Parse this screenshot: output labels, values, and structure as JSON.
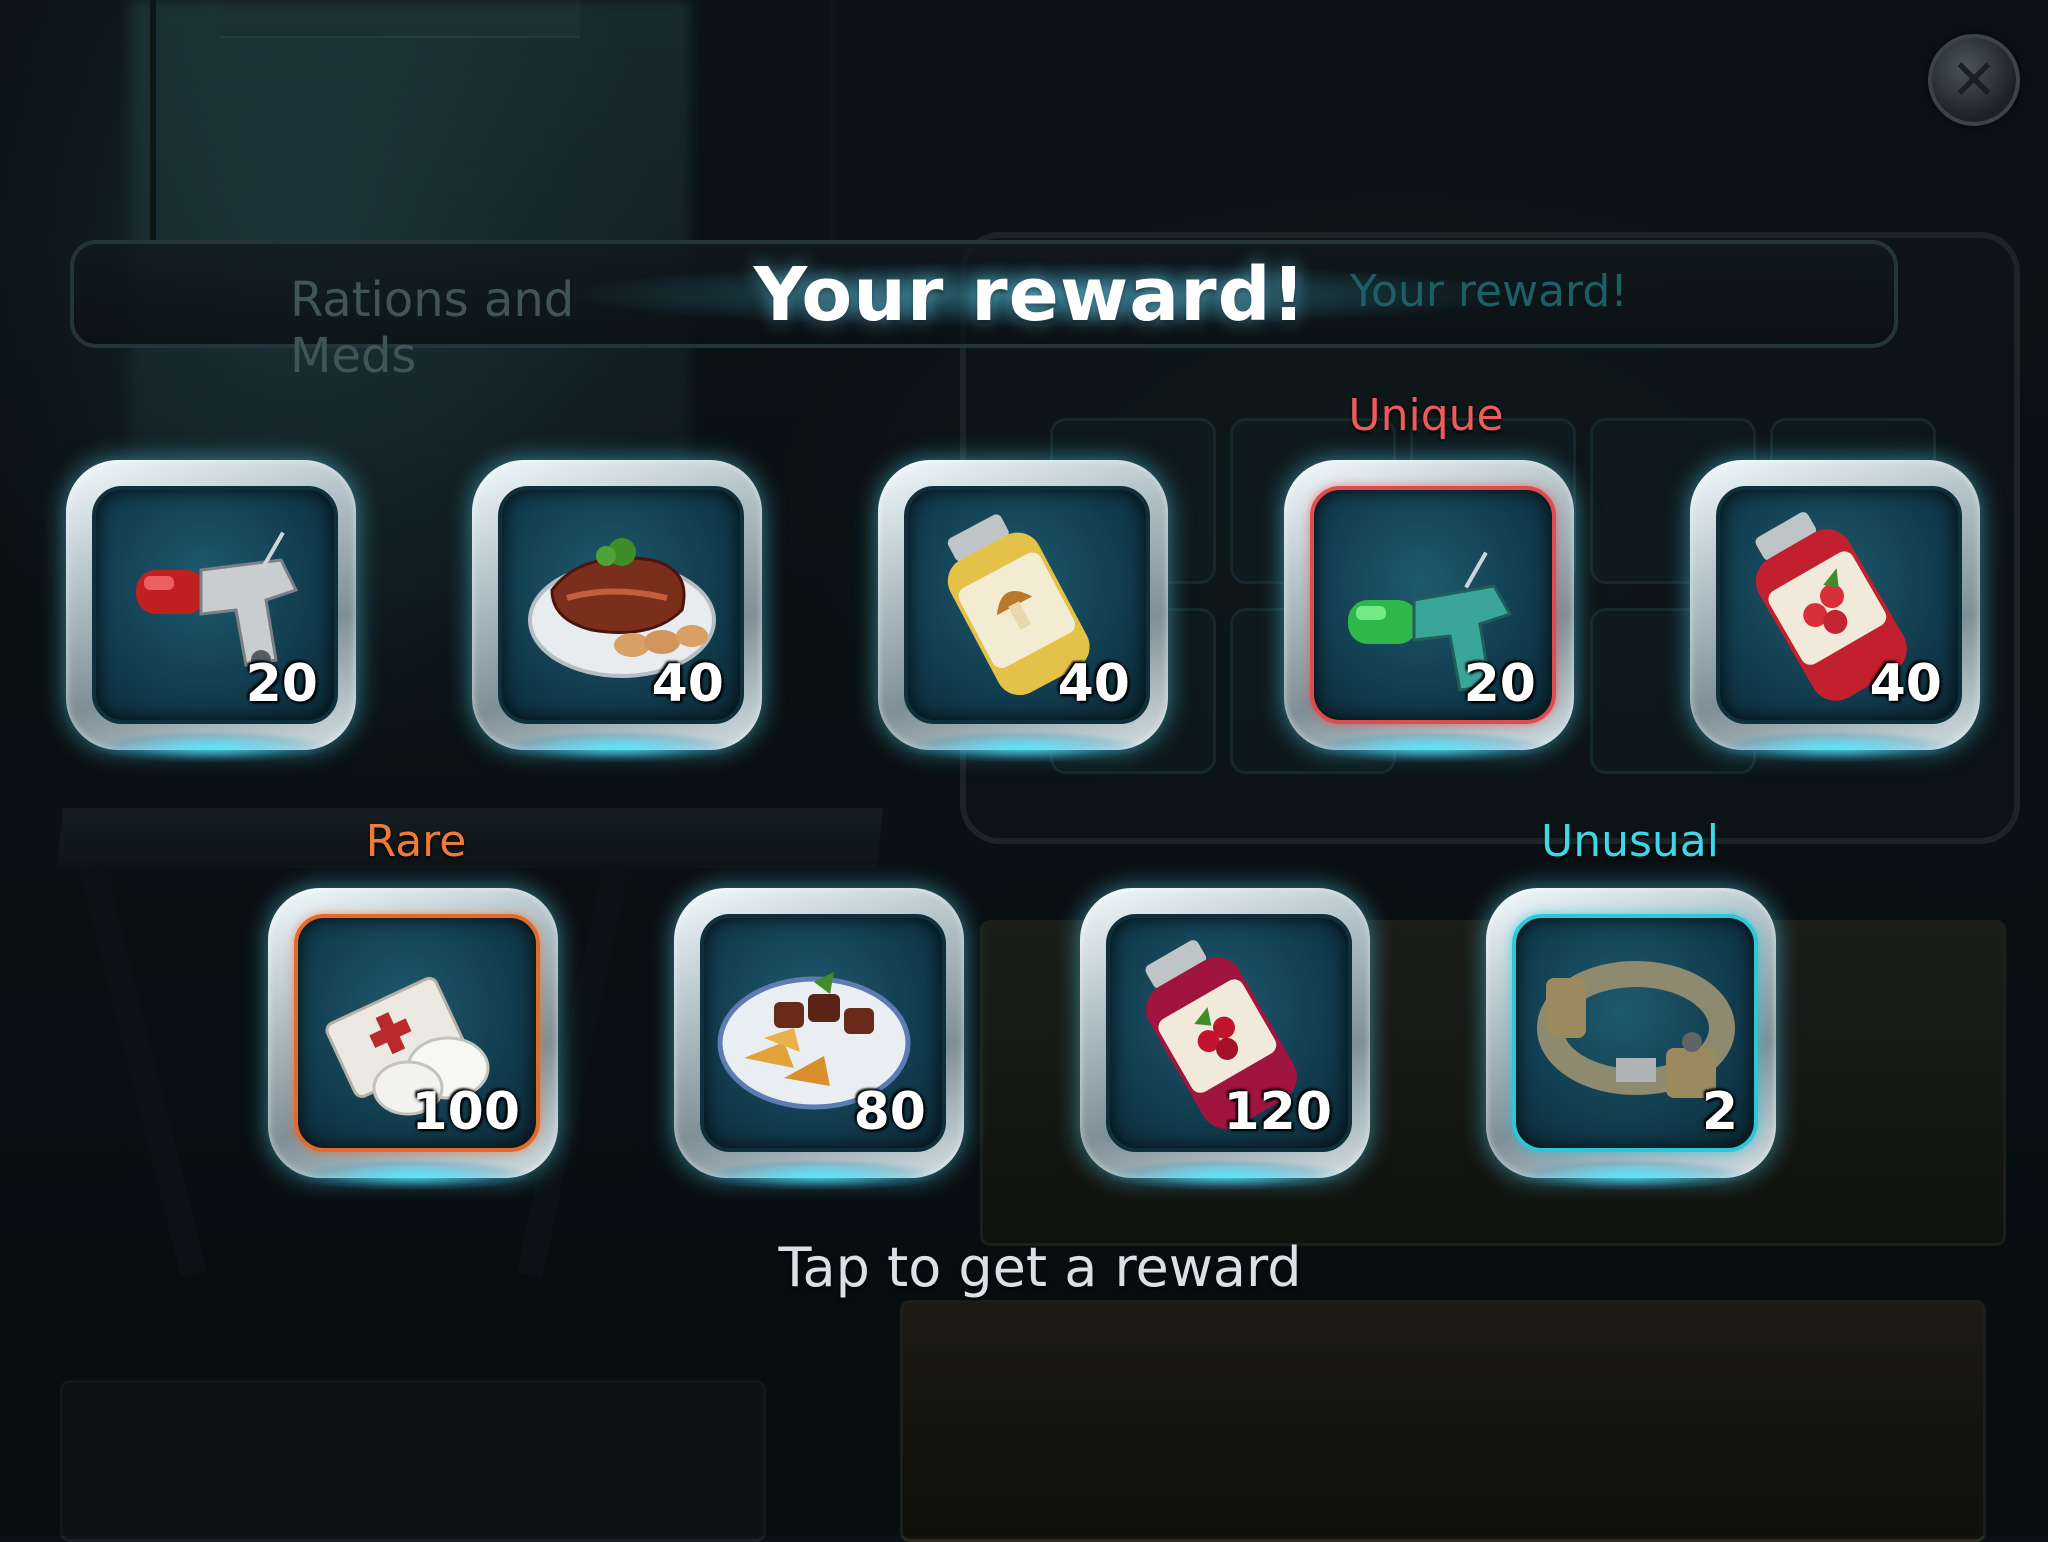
{
  "header": {
    "title": "Your reward!",
    "tab_left": "Rations and Meds",
    "tab_right": "Your reward!"
  },
  "close_icon": "close-icon",
  "rewards_top": [
    {
      "item": "syringe-injector-red-icon",
      "count": "20",
      "rarity": ""
    },
    {
      "item": "steak-plate-icon",
      "count": "40",
      "rarity": ""
    },
    {
      "item": "mushroom-jar-icon",
      "count": "40",
      "rarity": ""
    },
    {
      "item": "syringe-injector-green-icon",
      "count": "20",
      "rarity": "Unique"
    },
    {
      "item": "berry-jar-icon",
      "count": "40",
      "rarity": ""
    }
  ],
  "rewards_bottom": [
    {
      "item": "bandage-icon",
      "count": "100",
      "rarity": "Rare"
    },
    {
      "item": "meat-potato-plate-icon",
      "count": "80",
      "rarity": ""
    },
    {
      "item": "cranberry-jar-icon",
      "count": "120",
      "rarity": ""
    },
    {
      "item": "tactical-belt-icon",
      "count": "2",
      "rarity": "Unusual"
    }
  ],
  "hint": "Tap to get a reward",
  "colors": {
    "rare": "#f07a3a",
    "unique": "#f05a5a",
    "unusual": "#3fd6e8",
    "glow": "#5ae0ff"
  }
}
